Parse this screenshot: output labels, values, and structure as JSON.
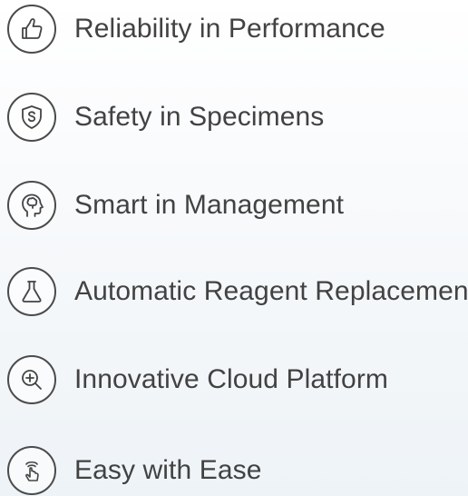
{
  "features": [
    {
      "label": "Reliability in Performance",
      "icon": "thumbs-up-icon"
    },
    {
      "label": "Safety in Specimens",
      "icon": "shield-s-icon"
    },
    {
      "label": "Smart in Management",
      "icon": "brain-head-icon"
    },
    {
      "label": "Automatic Reagent Replacement",
      "icon": "flask-icon"
    },
    {
      "label": "Innovative Cloud Platform",
      "icon": "zoom-in-icon"
    },
    {
      "label": "Easy with Ease",
      "icon": "touch-hand-icon"
    }
  ]
}
